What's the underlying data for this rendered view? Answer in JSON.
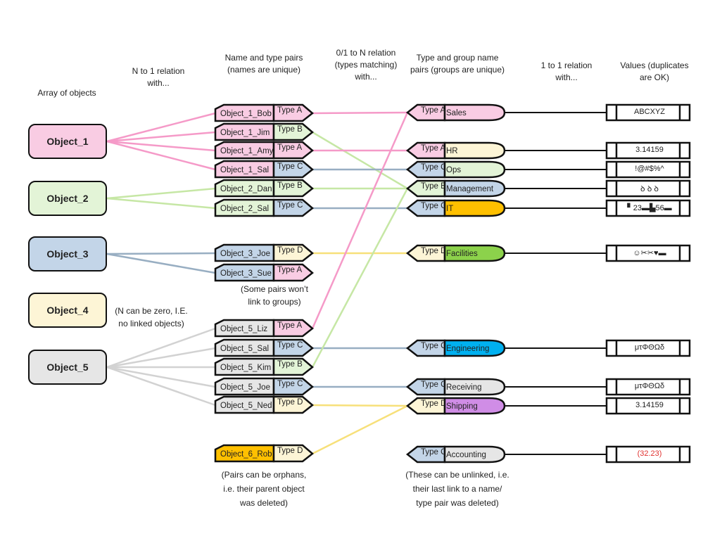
{
  "colors": {
    "pink": "#f9cce3",
    "green": "#e3f4d7",
    "blue": "#c3d5e8",
    "yellow": "#fdf5d6",
    "gray": "#e6e6e6",
    "orange": "#ffc000",
    "lime": "#8cd24b",
    "cyan": "#00b0f0",
    "violet": "#d08de6",
    "line_pink": "#f59ac8",
    "line_green": "#c6e7a5",
    "line_blue": "#98aec2",
    "line_yellow": "#f7e07a",
    "line_gray": "#d2d2d2",
    "red_text": "#e0312f"
  },
  "headers": {
    "objects": "Array of objects",
    "n_to_1": [
      "N to 1 relation",
      "with..."
    ],
    "pairs": [
      "Name and type pairs",
      "(names are unique)"
    ],
    "zero_one_to_n": [
      "0/1 to N relation",
      "(types matching)",
      "with..."
    ],
    "groups": [
      "Type and group name",
      "pairs (groups are unique)"
    ],
    "one_to_one": [
      "1 to 1 relation",
      "with..."
    ],
    "values": [
      "Values (duplicates",
      "are OK)"
    ]
  },
  "objects": [
    {
      "name": "Object_1",
      "color": "pink"
    },
    {
      "name": "Object_2",
      "color": "green"
    },
    {
      "name": "Object_3",
      "color": "blue"
    },
    {
      "name": "Object_4",
      "color": "yellow"
    },
    {
      "name": "Object_5",
      "color": "gray"
    }
  ],
  "pairs": [
    {
      "name": "Object_1_Bob",
      "type": "Type A",
      "parent": 0,
      "group": 0
    },
    {
      "name": "Object_1_Jim",
      "type": "Type B",
      "parent": 0,
      "group": 3
    },
    {
      "name": "Object_1_Amy",
      "type": "Type A",
      "parent": 0,
      "group": 1
    },
    {
      "name": "Object_1_Sal",
      "type": "Type C",
      "parent": 0,
      "group": 2
    },
    {
      "name": "Object_2_Dan",
      "type": "Type B",
      "parent": 1,
      "group": 3
    },
    {
      "name": "Object_2_Sal",
      "type": "Type C",
      "parent": 1,
      "group": 4
    },
    {
      "name": "Object_3_Joe",
      "type": "Type D",
      "parent": 2,
      "group": 5
    },
    {
      "name": "Object_3_Sue",
      "type": "Type A",
      "parent": 2,
      "group": null
    },
    {
      "name": "Object_5_Liz",
      "type": "Type A",
      "parent": 4,
      "group": 0
    },
    {
      "name": "Object_5_Sal",
      "type": "Type C",
      "parent": 4,
      "group": 6
    },
    {
      "name": "Object_5_Kim",
      "type": "Type B",
      "parent": 4,
      "group": 3
    },
    {
      "name": "Object_5_Joe",
      "type": "Type C",
      "parent": 4,
      "group": 7
    },
    {
      "name": "Object_5_Ned",
      "type": "Type D",
      "parent": 4,
      "group": 8
    },
    {
      "name": "Object_6_Rob",
      "type": "Type D",
      "parent": null,
      "group": 8
    }
  ],
  "groups": [
    {
      "type": "Type A",
      "name": "Sales",
      "fill": "pink"
    },
    {
      "type": "Type A",
      "name": "HR",
      "fill": "yellow"
    },
    {
      "type": "Type C",
      "name": "Ops",
      "fill": "green"
    },
    {
      "type": "Type B",
      "name": "Management",
      "fill": "blue"
    },
    {
      "type": "Type C",
      "name": "IT",
      "fill": "orange"
    },
    {
      "type": "Type D",
      "name": "Facilities",
      "fill": "lime"
    },
    {
      "type": "Type C",
      "name": "Engineering",
      "fill": "cyan"
    },
    {
      "type": "Type C",
      "name": "Receiving",
      "fill": "gray"
    },
    {
      "type": "Type D",
      "name": "Shipping",
      "fill": "violet"
    },
    {
      "type": "Type C",
      "name": "Accounting",
      "fill": "gray"
    }
  ],
  "values": [
    {
      "text": "ABCXYZ"
    },
    {
      "text": "3.14159"
    },
    {
      "text": "!@#$%^"
    },
    {
      "text": "ꝺ ꝺ ꝺ"
    },
    {
      "text": "▘23▬▙56▬"
    },
    {
      "text": "☺✂✂♥▬"
    },
    {
      "text": "μτΦΘΩδ"
    },
    {
      "text": "μτΦΘΩδ"
    },
    {
      "text": "3.14159"
    },
    {
      "text": "(32.23)",
      "negative": true
    }
  ],
  "notes": {
    "n_zero": [
      "(N can be zero, I.E.",
      "no linked objects)"
    ],
    "no_group": [
      "(Some pairs won’t",
      "link to groups)"
    ],
    "orphans": [
      "(Pairs can be orphans,",
      "i.e. their parent object",
      "was deleted)"
    ],
    "unlinked": [
      "(These can be unlinked, i.e.",
      "their last link to a name/",
      "type pair was deleted)"
    ]
  }
}
